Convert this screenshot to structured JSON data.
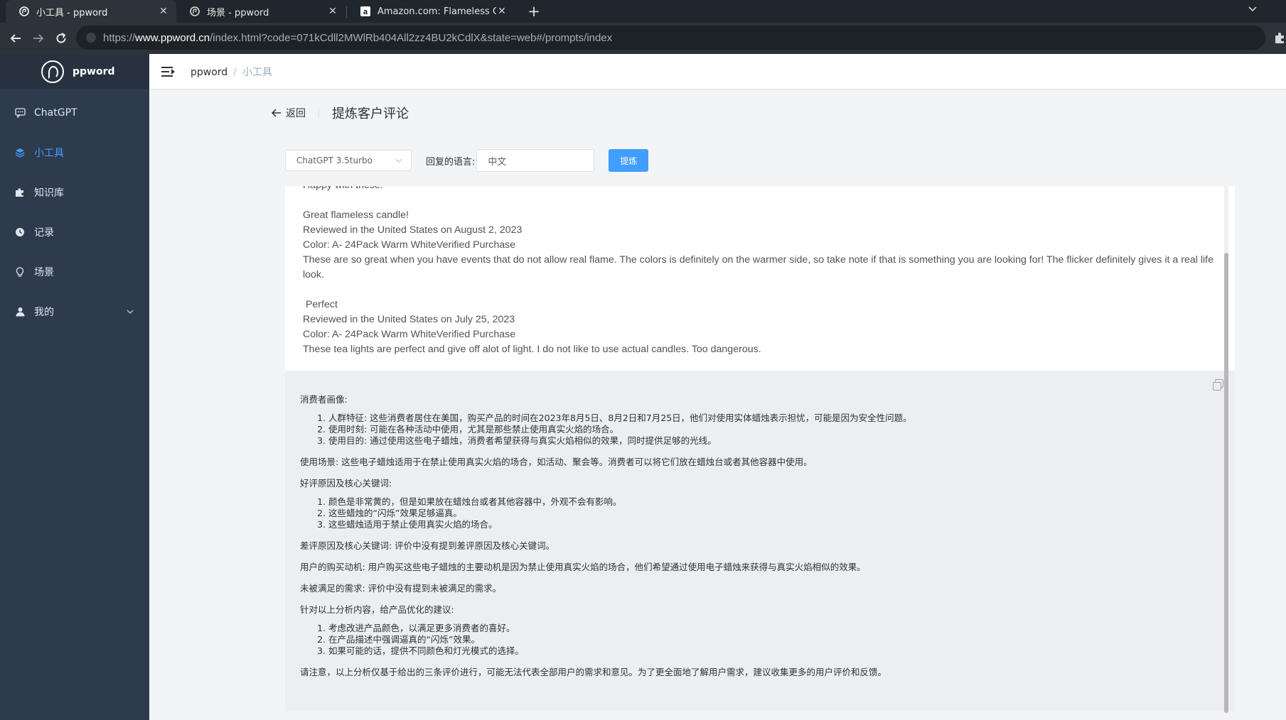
{
  "browser": {
    "tabs": [
      {
        "title": "小工具 - ppword",
        "close": "✕"
      },
      {
        "title": "场景 - ppword",
        "close": "✕"
      },
      {
        "title": "Amazon.com: Flameless Candl",
        "close": "✕"
      }
    ],
    "new_tab": "+",
    "url_scheme": "https://",
    "url_host": "www.ppword.cn",
    "url_path": "/index.html?code=071kCdll2MWlRb404All2zz4BU2kCdlX&state=web#/prompts/index"
  },
  "app": {
    "name": "ppword",
    "sidebar": {
      "items": [
        {
          "label": "ChatGPT",
          "icon": "chat-icon"
        },
        {
          "label": "小工具",
          "icon": "layers-icon"
        },
        {
          "label": "知识库",
          "icon": "puzzle-icon"
        },
        {
          "label": "记录",
          "icon": "clock-icon"
        },
        {
          "label": "场景",
          "icon": "bulb-icon"
        },
        {
          "label": "我的",
          "icon": "user-icon"
        }
      ]
    },
    "breadcrumb": {
      "root": "ppword",
      "current": "小工具"
    }
  },
  "page": {
    "back_label": "返回",
    "title": "提炼客户评论",
    "model_select": "ChatGPT 3.5turbo",
    "lang_label": "回复的语言:",
    "lang_value": "中文",
    "refine_button": "提炼"
  },
  "reviews": {
    "top_partial": "Happy with these.",
    "r1_title": "Great flameless candle!",
    "r1_date": "Reviewed in the United States on August 2, 2023",
    "r1_color": "Color: A- 24Pack Warm WhiteVerified Purchase",
    "r1_body": "These are so great when you have events that do not allow real flame. The colors is definitely on the warmer side, so take note if that is something you are looking for! The flicker definitely gives it a real life look.",
    "r2_title": " Perfect",
    "r2_date": "Reviewed in the United States on July 25, 2023",
    "r2_color": "Color: A- 24Pack Warm WhiteVerified Purchase",
    "r2_body": "These tea lights are perfect and give off alot of light. I do not like to use actual candles. Too dangerous."
  },
  "result": {
    "h1": "消费者画像:",
    "l1": [
      "人群特征: 这些消费者居住在美国，购买产品的时间在2023年8月5日、8月2日和7月25日，他们对使用实体蜡烛表示担忧，可能是因为安全性问题。",
      "使用时刻: 可能在各种活动中使用，尤其是那些禁止使用真实火焰的场合。",
      "使用目的: 通过使用这些电子蜡烛，消费者希望获得与真实火焰相似的效果，同时提供足够的光线。"
    ],
    "p2": "使用场景: 这些电子蜡烛适用于在禁止使用真实火焰的场合，如活动、聚会等。消费者可以将它们放在蜡烛台或者其他容器中使用。",
    "h3": "好评原因及核心关键词:",
    "l3": [
      "颜色是非常黄的，但是如果放在蜡烛台或者其他容器中，外观不会有影响。",
      "这些蜡烛的“闪烁”效果足够逼真。",
      "这些蜡烛适用于禁止使用真实火焰的场合。"
    ],
    "p4": "差评原因及核心关键词: 评价中没有提到差评原因及核心关键词。",
    "p5": "用户的购买动机: 用户购买这些电子蜡烛的主要动机是因为禁止使用真实火焰的场合，他们希望通过使用电子蜡烛来获得与真实火焰相似的效果。",
    "p6": "未被满足的需求: 评价中没有提到未被满足的需求。",
    "h7": "针对以上分析内容，给产品优化的建议:",
    "l7": [
      "考虑改进产品颜色，以满足更多消费者的喜好。",
      "在产品描述中强调逼真的“闪烁”效果。",
      "如果可能的话，提供不同颜色和灯光模式的选择。"
    ],
    "p8": "请注意，以上分析仅基于给出的三条评价进行，可能无法代表全部用户的需求和意见。为了更全面地了解用户需求，建议收集更多的用户评价和反馈。"
  }
}
